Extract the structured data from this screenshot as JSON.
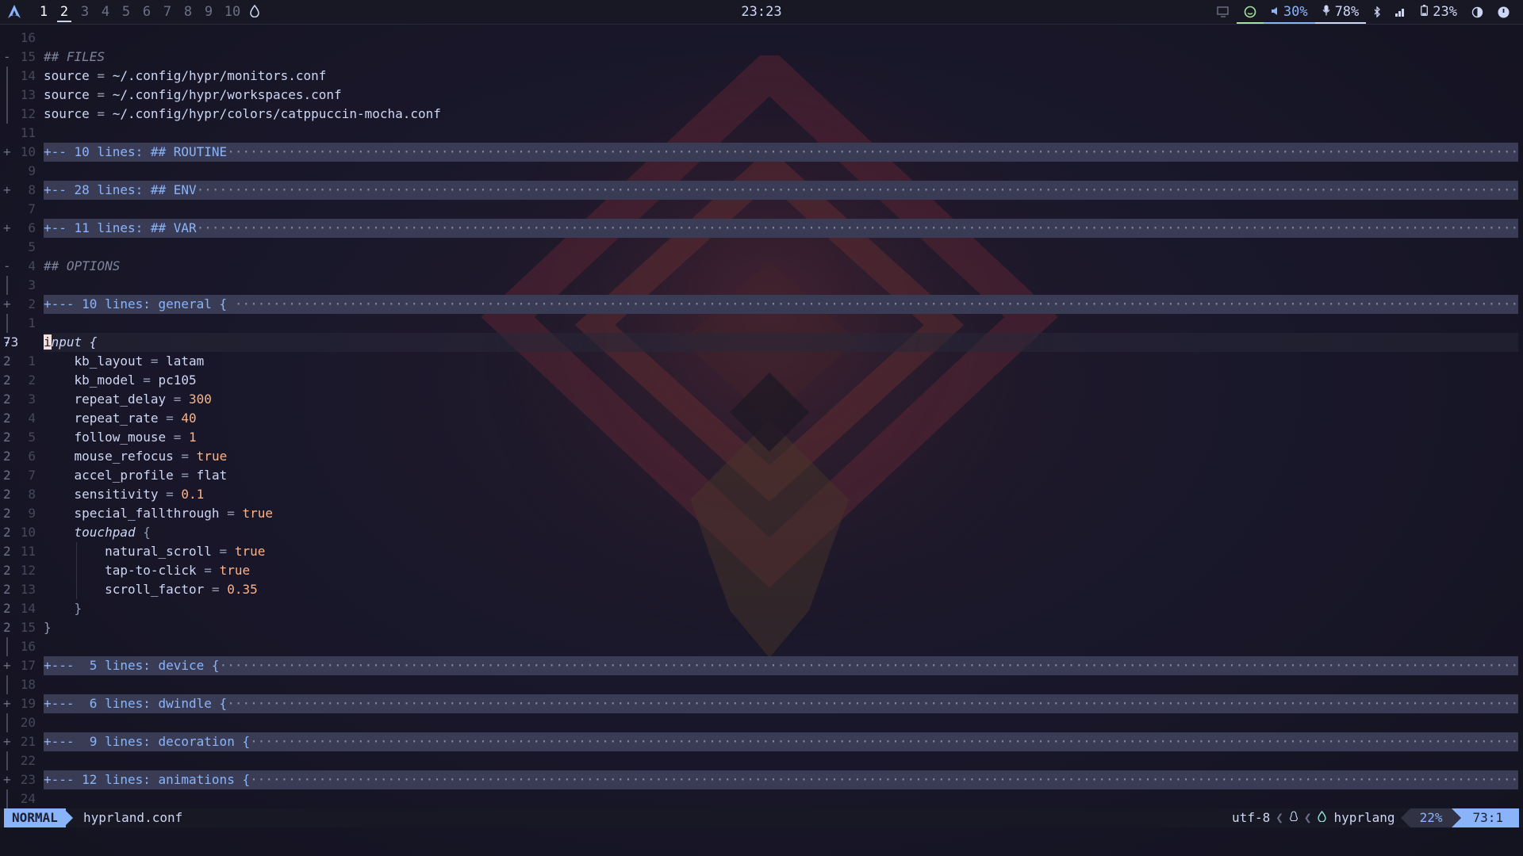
{
  "topbar": {
    "workspaces": [
      "1",
      "2",
      "3",
      "4",
      "5",
      "6",
      "7",
      "8",
      "9",
      "10"
    ],
    "active_workspace": "2",
    "clock": "23:23",
    "volume": "30%",
    "mic": "78%",
    "battery": "23%",
    "icons": {
      "logo": "arch-logo-icon",
      "drop": "water-drop-icon",
      "screen": "screen-icon",
      "status": "status-face-icon",
      "volume": "speaker-icon",
      "mic": "microphone-icon",
      "bluetooth": "bluetooth-icon",
      "signal": "signal-icon",
      "battery": "battery-icon",
      "theme": "theme-contrast-icon",
      "power": "power-icon"
    }
  },
  "editor": {
    "lines": [
      {
        "num": "16",
        "fold": "",
        "text": ""
      },
      {
        "num": "15",
        "fold": "-",
        "text": "## FILES",
        "kind": "comment"
      },
      {
        "num": "14",
        "fold": "|",
        "text": "source = ~/.config/hypr/monitors.conf"
      },
      {
        "num": "13",
        "fold": "|",
        "text": "source = ~/.config/hypr/workspaces.conf"
      },
      {
        "num": "12",
        "fold": "|",
        "text": "source = ~/.config/hypr/colors/catppuccin-mocha.conf"
      },
      {
        "num": "11",
        "fold": "",
        "text": ""
      },
      {
        "num": "10",
        "fold": "+",
        "text": "+-- 10 lines: ## ROUTINE",
        "kind": "fold"
      },
      {
        "num": "9",
        "fold": "",
        "text": ""
      },
      {
        "num": "8",
        "fold": "+",
        "text": "+-- 28 lines: ## ENV",
        "kind": "fold"
      },
      {
        "num": "7",
        "fold": "",
        "text": ""
      },
      {
        "num": "6",
        "fold": "+",
        "text": "+-- 11 lines: ## VAR",
        "kind": "fold"
      },
      {
        "num": "5",
        "fold": "",
        "text": ""
      },
      {
        "num": "4",
        "fold": "-",
        "text": "## OPTIONS",
        "kind": "comment"
      },
      {
        "num": "3",
        "fold": "|",
        "text": ""
      },
      {
        "num": "2",
        "fold": "+",
        "text": "+--- 10 lines: general { ",
        "kind": "fold"
      },
      {
        "num": "1",
        "fold": "|",
        "text": ""
      },
      {
        "num": "73",
        "fold": "-",
        "text": "input {",
        "kind": "current"
      },
      {
        "num": "1",
        "fold": "2",
        "text": "    kb_layout = latam"
      },
      {
        "num": "2",
        "fold": "2",
        "text": "    kb_model = pc105"
      },
      {
        "num": "3",
        "fold": "2",
        "text": "    repeat_delay = 300"
      },
      {
        "num": "4",
        "fold": "2",
        "text": "    repeat_rate = 40"
      },
      {
        "num": "5",
        "fold": "2",
        "text": "    follow_mouse = 1"
      },
      {
        "num": "6",
        "fold": "2",
        "text": "    mouse_refocus = true"
      },
      {
        "num": "7",
        "fold": "2",
        "text": "    accel_profile = flat"
      },
      {
        "num": "8",
        "fold": "2",
        "text": "    sensitivity = 0.1"
      },
      {
        "num": "9",
        "fold": "2",
        "text": "    special_fallthrough = true"
      },
      {
        "num": "10",
        "fold": "2",
        "text": "    touchpad {"
      },
      {
        "num": "11",
        "fold": "2",
        "text": "        natural_scroll = true"
      },
      {
        "num": "12",
        "fold": "2",
        "text": "        tap-to-click = true"
      },
      {
        "num": "13",
        "fold": "2",
        "text": "        scroll_factor = 0.35"
      },
      {
        "num": "14",
        "fold": "2",
        "text": "    }"
      },
      {
        "num": "15",
        "fold": "2",
        "text": "}"
      },
      {
        "num": "16",
        "fold": "|",
        "text": ""
      },
      {
        "num": "17",
        "fold": "+",
        "text": "+---  5 lines: device {",
        "kind": "fold"
      },
      {
        "num": "18",
        "fold": "|",
        "text": ""
      },
      {
        "num": "19",
        "fold": "+",
        "text": "+---  6 lines: dwindle {",
        "kind": "fold"
      },
      {
        "num": "20",
        "fold": "|",
        "text": ""
      },
      {
        "num": "21",
        "fold": "+",
        "text": "+---  9 lines: decoration {",
        "kind": "fold"
      },
      {
        "num": "22",
        "fold": "|",
        "text": ""
      },
      {
        "num": "23",
        "fold": "+",
        "text": "+--- 12 lines: animations {",
        "kind": "fold"
      },
      {
        "num": "24",
        "fold": "|",
        "text": ""
      }
    ]
  },
  "statusline": {
    "mode": "NORMAL",
    "filename": "hyprland.conf",
    "encoding": "utf-8",
    "filetype": "hyprlang",
    "percent": "22%",
    "position": "73:1"
  }
}
